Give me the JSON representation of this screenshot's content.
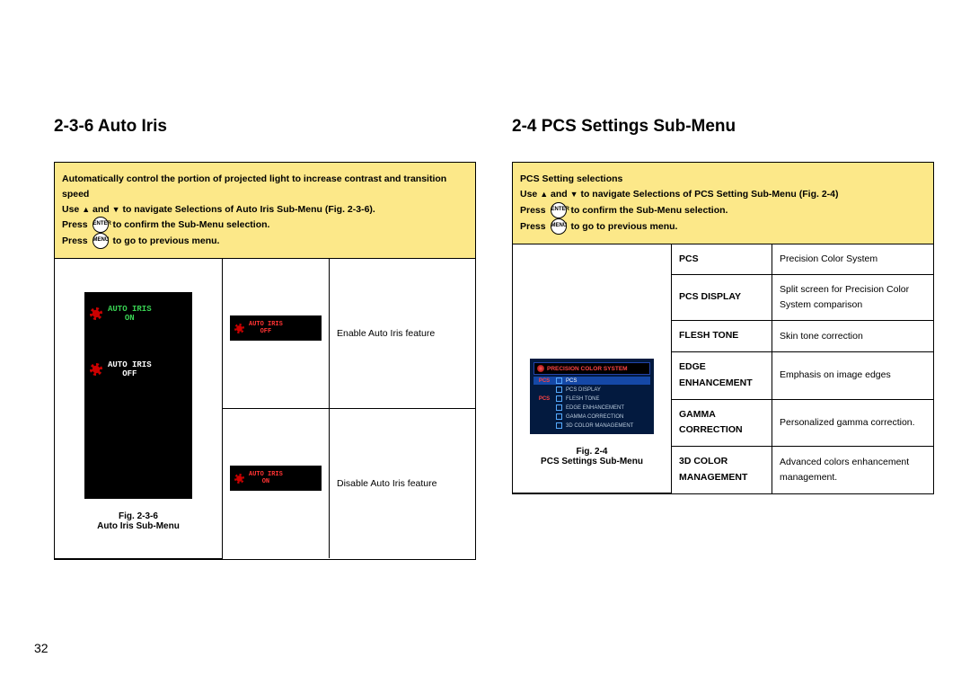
{
  "page_number": "32",
  "left": {
    "heading": "2-3-6 Auto Iris",
    "header_line1": "Automatically control the portion of projected light to increase contrast and transition speed",
    "header_line2a": "Use ",
    "header_line2b": " and ",
    "header_line2c": " to navigate Selections of Auto Iris Sub-Menu (Fig. 2-3-6).",
    "header_line3a": "Press ",
    "header_line3b": " to confirm the Sub-Menu selection.",
    "header_line4a": "Press ",
    "header_line4b": " to go to previous menu.",
    "osd_on_label": "AUTO IRIS",
    "osd_on_val": "ON",
    "osd_off_label": "AUTO IRIS",
    "osd_off_val": "OFF",
    "fig_num": "Fig. 2-3-6",
    "fig_caption": "Auto Iris Sub-Menu",
    "row1_icon_label": "AUTO IRIS",
    "row1_icon_val": "OFF",
    "row1_desc": "Enable Auto Iris feature",
    "row2_icon_label": "AUTO IRIS",
    "row2_icon_val": "ON",
    "row2_desc": "Disable Auto Iris feature"
  },
  "right": {
    "heading": "2-4 PCS Settings Sub-Menu",
    "header_line1": "PCS Setting selections",
    "header_line2a": "Use ",
    "header_line2b": " and ",
    "header_line2c": " to navigate Selections of PCS Setting Sub-Menu (Fig. 2-4)",
    "header_line3a": "Press ",
    "header_line3b": " to confirm the Sub-Menu selection.",
    "header_line4a": "Press ",
    "header_line4b": " to go to previous menu.",
    "fig_num": "Fig. 2-4",
    "fig_caption": "PCS Settings Sub-Menu",
    "pcs_title": "PRECISION COLOR SYSTEM",
    "pcs_items": [
      "PCS",
      "PCS DISPLAY",
      "FLESH TONE",
      "EDGE ENHANCEMENT",
      "GAMMA CORRECTION",
      "3D COLOR MANAGEMENT"
    ],
    "pcs_left1": "PCS",
    "pcs_left2": "PCS",
    "rows": [
      {
        "label": "PCS",
        "desc": "Precision Color System"
      },
      {
        "label": "PCS DISPLAY",
        "desc": "Split screen for Precision Color System comparison"
      },
      {
        "label": "FLESH TONE",
        "desc": "Skin tone correction"
      },
      {
        "label": "EDGE ENHANCEMENT",
        "desc": "Emphasis on image edges"
      },
      {
        "label": "GAMMA CORRECTION",
        "desc": "Personalized gamma correction."
      },
      {
        "label": "3D COLOR MANAGEMENT",
        "desc": "Advanced colors enhancement management."
      }
    ]
  },
  "enter_btn": "ENTER",
  "menu_btn": "MENU"
}
